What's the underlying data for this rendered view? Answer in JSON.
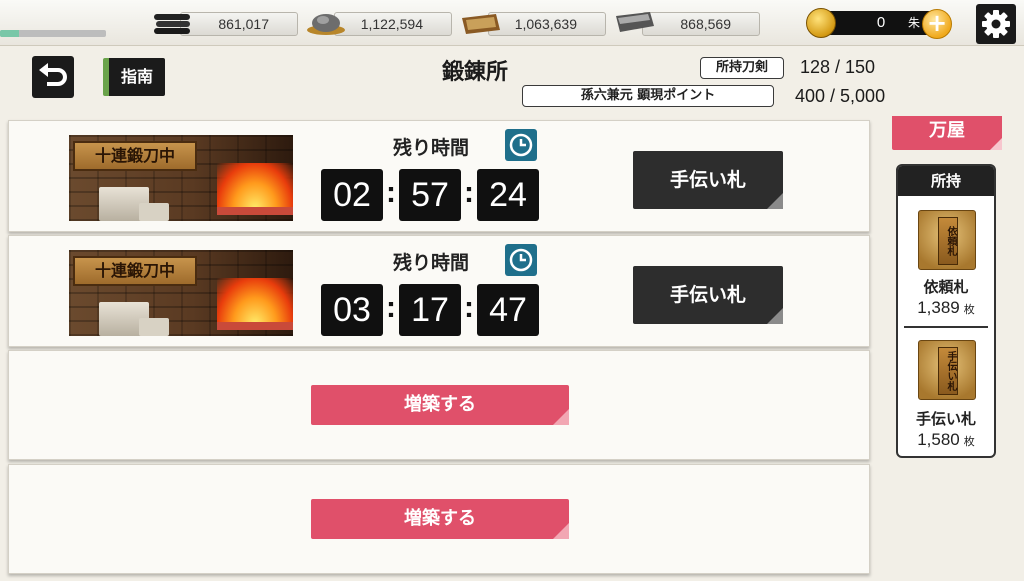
{
  "resources": {
    "progress": 0.18,
    "items": [
      {
        "id": "charcoal",
        "icon": "charcoal-icon",
        "value": "861,017"
      },
      {
        "id": "steel",
        "icon": "tamahagane-icon",
        "value": "1,122,594"
      },
      {
        "id": "coolant",
        "icon": "coolant-icon",
        "value": "1,063,639"
      },
      {
        "id": "whetstone",
        "icon": "whetstone-icon",
        "value": "868,569"
      }
    ],
    "coins": {
      "value": "0",
      "unit": "朱",
      "icon": "koban-coin-icon"
    }
  },
  "header": {
    "back_icon": "back-arrow-icon",
    "guide_label": "指南",
    "title": "鍛錬所",
    "swords_label": "所持刀剣",
    "swords_value": "128  /  150",
    "points_label": "孫六兼元 顕現ポイント",
    "points_value": "400  / 5,000"
  },
  "slots": [
    {
      "banner_text": "十連鍛刀中",
      "remaining_label": "残り時間",
      "hours": "02",
      "minutes": "57",
      "seconds": "24",
      "help_label": "手伝い札"
    },
    {
      "banner_text": "十連鍛刀中",
      "remaining_label": "残り時間",
      "hours": "03",
      "minutes": "17",
      "seconds": "47",
      "help_label": "手伝い札"
    }
  ],
  "expansions": [
    {
      "label": "増築する"
    },
    {
      "label": "増築する"
    }
  ],
  "sidebar": {
    "shop_label": "万屋",
    "owned_header": "所持",
    "items": [
      {
        "name": "依頼札",
        "tag_text": "依頼札",
        "count": "1,389",
        "unit": "枚"
      },
      {
        "name": "手伝い札",
        "tag_text": "手伝い札",
        "count": "1,580",
        "unit": "枚"
      }
    ]
  },
  "colors": {
    "accent_pink": "#e0506a",
    "dark": "#1b1b1b",
    "clock": "#1f6f8b"
  }
}
